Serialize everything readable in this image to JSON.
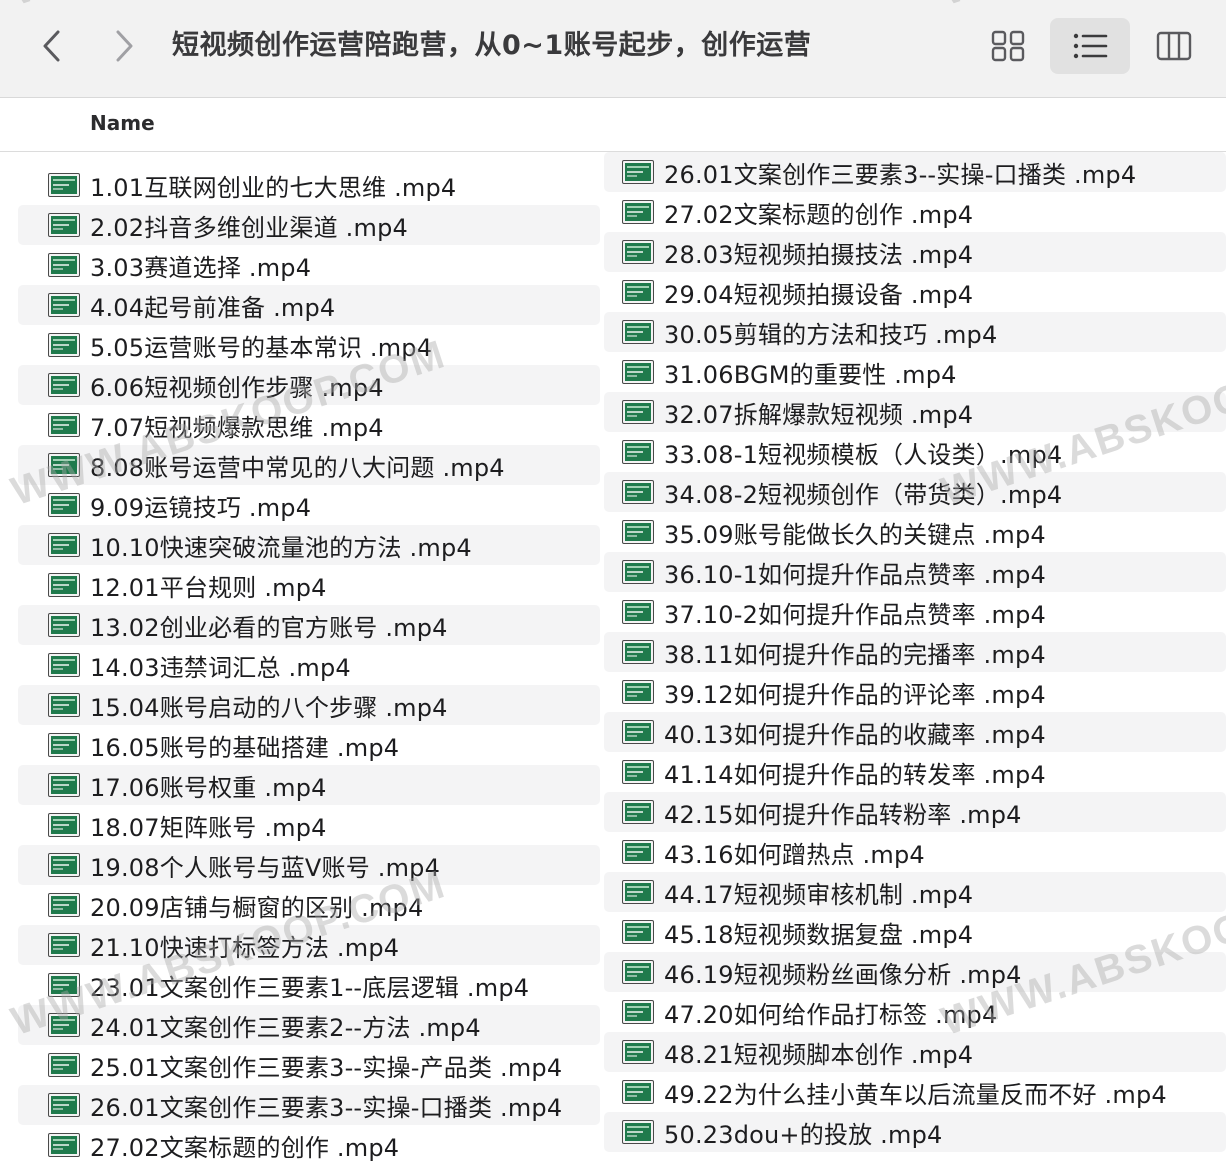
{
  "toolbar": {
    "title": "短视频创作运营陪跑营，从0~1账号起步，创作运营",
    "back_icon": "chevron-left-icon",
    "forward_icon": "chevron-right-icon",
    "view_grid_icon": "grid-view-icon",
    "view_list_icon": "list-view-icon",
    "view_columns_icon": "column-view-icon"
  },
  "header": {
    "name_label": "Name"
  },
  "colors": {
    "icon_green": "#1f7a4c",
    "toolbar_bg": "#f2f2f2",
    "selected_view_bg": "#e1e1e1",
    "row_alt_bg": "#f4f4f5"
  },
  "files_left": [
    "1.01互联网创业的七大思维 .mp4",
    "2.02抖音多维创业渠道 .mp4",
    "3.03赛道选择 .mp4",
    "4.04起号前准备  .mp4",
    "5.05运营账号的基本常识  .mp4",
    "6.06短视频创作步骤  .mp4",
    "7.07短视频爆款思维 .mp4",
    "8.08账号运营中常见的八大问题 .mp4",
    "9.09运镜技巧  .mp4",
    "10.10快速突破流量池的方法  .mp4",
    "12.01平台规则 .mp4",
    "13.02创业必看的官方账号 .mp4",
    "14.03违禁词汇总 .mp4",
    "15.04账号启动的八个步骤 .mp4",
    "16.05账号的基础搭建 .mp4",
    "17.06账号权重 .mp4",
    "18.07矩阵账号 .mp4",
    "19.08个人账号与蓝V账号 .mp4",
    "20.09店铺与橱窗的区别 .mp4",
    "21.10快速打标签方法 .mp4",
    "23.01文案创作三要素1--底层逻辑 .mp4",
    "24.01文案创作三要素2--方法 .mp4",
    "25.01文案创作三要素3--实操-产品类 .mp4",
    "26.01文案创作三要素3--实操-口播类 .mp4",
    "27.02文案标题的创作 .mp4"
  ],
  "files_right": [
    "26.01文案创作三要素3--实操-口播类 .mp4",
    "27.02文案标题的创作 .mp4",
    "28.03短视频拍摄技法 .mp4",
    "29.04短视频拍摄设备 .mp4",
    "30.05剪辑的方法和技巧 .mp4",
    "31.06BGM的重要性 .mp4",
    "32.07拆解爆款短视频 .mp4",
    "33.08-1短视频模板（人设类）.mp4",
    "34.08-2短视频创作（带货类）.mp4",
    "35.09账号能做长久的关键点 .mp4",
    "36.10-1如何提升作品点赞率 .mp4",
    "37.10-2如何提升作品点赞率 .mp4",
    "38.11如何提升作品的完播率 .mp4",
    "39.12如何提升作品的评论率 .mp4",
    "40.13如何提升作品的收藏率 .mp4",
    "41.14如何提升作品的转发率 .mp4",
    "42.15如何提升作品转粉率 .mp4",
    "43.16如何蹭热点 .mp4",
    "44.17短视频审核机制 .mp4",
    "45.18短视频数据复盘 .mp4",
    "46.19短视频粉丝画像分析 .mp4",
    "47.20如何给作品打标签 .mp4",
    "48.21短视频脚本创作 .mp4",
    "49.22为什么挂小黄车以后流量反而不好 .mp4",
    "50.23dou+的投放 .mp4"
  ],
  "watermark_text": "WWW.ABSKOOP.COM",
  "watermark_text_edge": "WWW.ABSKOO"
}
